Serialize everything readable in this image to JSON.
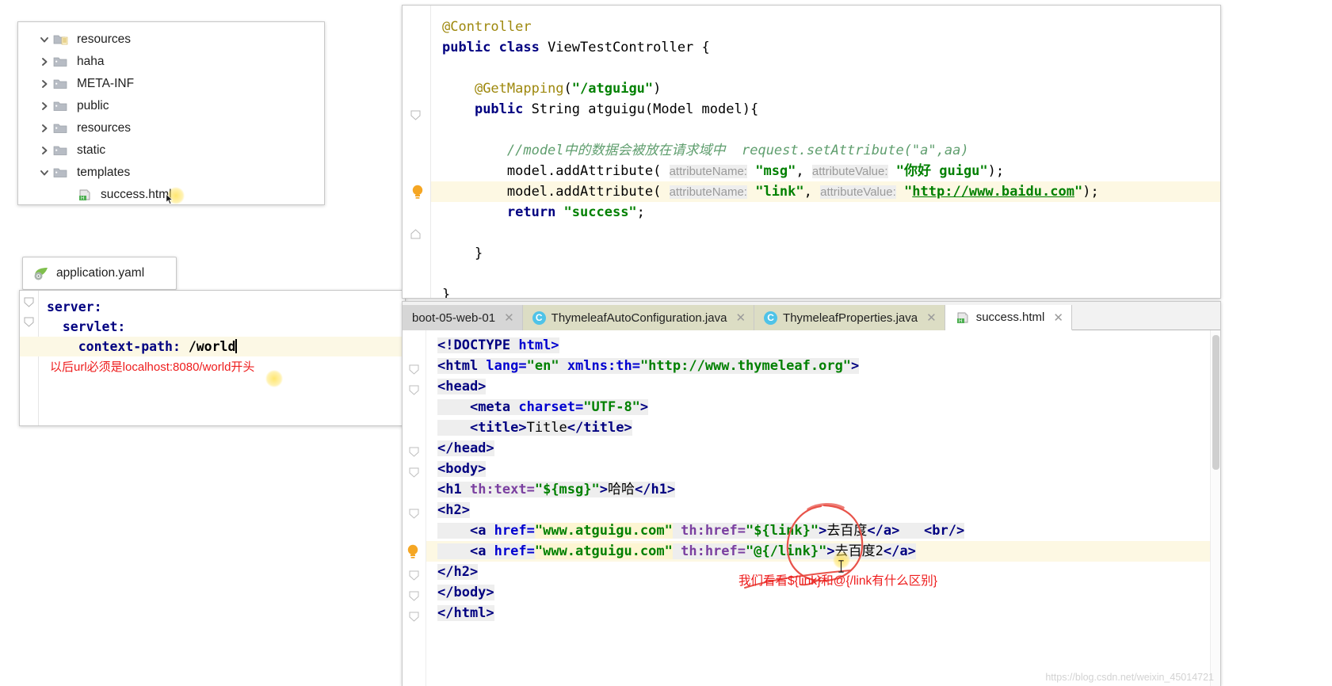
{
  "project_tree": {
    "rows": [
      {
        "label": "resources",
        "indent": 0,
        "arrow": "chevron-down",
        "icon": "resources-folder-icon",
        "expanded": true
      },
      {
        "label": "haha",
        "indent": 1,
        "arrow": "chevron-right",
        "icon": "folder-icon",
        "expanded": false
      },
      {
        "label": "META-INF",
        "indent": 1,
        "arrow": "chevron-right",
        "icon": "folder-icon",
        "expanded": false
      },
      {
        "label": "public",
        "indent": 1,
        "arrow": "chevron-right",
        "icon": "folder-icon",
        "expanded": false
      },
      {
        "label": "resources",
        "indent": 1,
        "arrow": "chevron-right",
        "icon": "folder-icon",
        "expanded": false
      },
      {
        "label": "static",
        "indent": 1,
        "arrow": "chevron-right",
        "icon": "folder-icon",
        "expanded": false
      },
      {
        "label": "templates",
        "indent": 1,
        "arrow": "chevron-down",
        "icon": "folder-icon",
        "expanded": true
      },
      {
        "label": "success.html",
        "indent": 2,
        "arrow": "none",
        "icon": "html-file-icon",
        "expanded": false
      }
    ]
  },
  "yaml_panel": {
    "tab_label": "application.yaml",
    "tab_icon": "spring-leaf-icon",
    "lines": [
      {
        "text": "server:",
        "kind": "key"
      },
      {
        "text": "  servlet:",
        "kind": "key"
      },
      {
        "text": "    context-path: ",
        "value": "/world",
        "kind": "key-value",
        "highlighted": true,
        "cursor": true
      },
      {
        "text": "以后url必须是localhost:8080/world开头",
        "kind": "red-note"
      }
    ]
  },
  "java_editor": {
    "lines": [
      {
        "id": "l1",
        "segments": [
          {
            "t": "@Controller",
            "c": "anno"
          }
        ]
      },
      {
        "id": "l2",
        "segments": [
          {
            "t": "public class ",
            "c": "kw"
          },
          {
            "t": "ViewTestController ",
            "c": "plain"
          },
          {
            "t": "{",
            "c": "plain"
          }
        ]
      },
      {
        "id": "l3",
        "segments": []
      },
      {
        "id": "l4",
        "segments": [
          {
            "t": "    ",
            "c": "plain"
          },
          {
            "t": "@GetMapping",
            "c": "anno"
          },
          {
            "t": "(",
            "c": "plain"
          },
          {
            "t": "\"/atguigu\"",
            "c": "str"
          },
          {
            "t": ")",
            "c": "plain"
          }
        ]
      },
      {
        "id": "l5",
        "segments": [
          {
            "t": "    ",
            "c": "plain"
          },
          {
            "t": "public ",
            "c": "kw"
          },
          {
            "t": "String atguigu(Model model){",
            "c": "plain"
          }
        ]
      },
      {
        "id": "l6",
        "segments": []
      },
      {
        "id": "l7",
        "segments": [
          {
            "t": "        //model中的数据会被放在请求域中  request.setAttribute(\"a\",aa)",
            "c": "cmt"
          }
        ]
      },
      {
        "id": "l8",
        "segments": [
          {
            "t": "        model.addAttribute( ",
            "c": "plain"
          },
          {
            "t": "attributeName:",
            "c": "hint"
          },
          {
            "t": " ",
            "c": "plain"
          },
          {
            "t": "\"msg\"",
            "c": "str"
          },
          {
            "t": ", ",
            "c": "plain"
          },
          {
            "t": "attributeValue:",
            "c": "hint"
          },
          {
            "t": " ",
            "c": "plain"
          },
          {
            "t": "\"你好 guigu\"",
            "c": "str"
          },
          {
            "t": ");",
            "c": "plain"
          }
        ]
      },
      {
        "id": "l9",
        "highlighted": true,
        "bulb": true,
        "segments": [
          {
            "t": "        model.addAttribute( ",
            "c": "plain"
          },
          {
            "t": "attributeName:",
            "c": "hint"
          },
          {
            "t": " ",
            "c": "plain"
          },
          {
            "t": "\"link\"",
            "c": "str"
          },
          {
            "t": ", ",
            "c": "plain"
          },
          {
            "t": "attributeValue:",
            "c": "hint"
          },
          {
            "t": " ",
            "c": "plain"
          },
          {
            "t": "\"",
            "c": "str"
          },
          {
            "t": "http://www.baidu.com",
            "c": "url"
          },
          {
            "t": "\"",
            "c": "str"
          },
          {
            "t": ");",
            "c": "plain"
          }
        ]
      },
      {
        "id": "l10",
        "segments": [
          {
            "t": "        ",
            "c": "plain"
          },
          {
            "t": "return ",
            "c": "kw"
          },
          {
            "t": "\"success\"",
            "c": "str"
          },
          {
            "t": ";",
            "c": "plain"
          }
        ]
      },
      {
        "id": "l11",
        "segments": []
      },
      {
        "id": "l12",
        "segments": [
          {
            "t": "    }",
            "c": "plain"
          }
        ]
      },
      {
        "id": "l13",
        "segments": []
      },
      {
        "id": "l14",
        "segments": [
          {
            "t": "}",
            "c": "plain"
          }
        ]
      }
    ]
  },
  "html_editor": {
    "tabs": [
      {
        "label": "boot-05-web-01",
        "icon": "none",
        "state": "inactive-grey",
        "closable": true
      },
      {
        "label": "ThymeleafAutoConfiguration.java",
        "icon": "class-icon",
        "state": "inactive-olive",
        "closable": true
      },
      {
        "label": "ThymeleafProperties.java",
        "icon": "class-icon",
        "state": "inactive-olive",
        "closable": true
      },
      {
        "label": "success.html",
        "icon": "html-file-icon",
        "state": "active",
        "closable": true
      }
    ],
    "lines": [
      {
        "id": "h1",
        "fold": false,
        "segments": [
          {
            "t": "<!DOCTYPE ",
            "c": "tag"
          },
          {
            "t": "html>",
            "c": "attr"
          }
        ]
      },
      {
        "id": "h2",
        "fold": true,
        "segments": [
          {
            "t": "<html ",
            "c": "tag"
          },
          {
            "t": "lang=",
            "c": "attr"
          },
          {
            "t": "\"en\"",
            "c": "str"
          },
          {
            "t": " ",
            "c": "txt"
          },
          {
            "t": "xmlns:th=",
            "c": "attr"
          },
          {
            "t": "\"http://www.thymeleaf.org\"",
            "c": "str"
          },
          {
            "t": ">",
            "c": "tag"
          }
        ]
      },
      {
        "id": "h3",
        "fold": true,
        "segments": [
          {
            "t": "<head>",
            "c": "tag"
          }
        ]
      },
      {
        "id": "h4",
        "fold": false,
        "segments": [
          {
            "t": "    ",
            "c": "txt"
          },
          {
            "t": "<meta ",
            "c": "tag"
          },
          {
            "t": "charset=",
            "c": "attr"
          },
          {
            "t": "\"UTF-8\"",
            "c": "str"
          },
          {
            "t": ">",
            "c": "tag"
          }
        ]
      },
      {
        "id": "h5",
        "fold": false,
        "segments": [
          {
            "t": "    ",
            "c": "txt"
          },
          {
            "t": "<title>",
            "c": "tag"
          },
          {
            "t": "Title",
            "c": "txt"
          },
          {
            "t": "</title>",
            "c": "tag"
          }
        ]
      },
      {
        "id": "h6",
        "fold": true,
        "segments": [
          {
            "t": "</head>",
            "c": "tag"
          }
        ]
      },
      {
        "id": "h7",
        "fold": true,
        "segments": [
          {
            "t": "<body>",
            "c": "tag"
          }
        ]
      },
      {
        "id": "h8",
        "fold": false,
        "segments": [
          {
            "t": "<h1 ",
            "c": "tag"
          },
          {
            "t": "th:text=",
            "c": "th"
          },
          {
            "t": "\"${msg}\"",
            "c": "str"
          },
          {
            "t": ">",
            "c": "tag"
          },
          {
            "t": "哈哈",
            "c": "txt"
          },
          {
            "t": "</h1>",
            "c": "tag"
          }
        ]
      },
      {
        "id": "h9",
        "fold": true,
        "segments": [
          {
            "t": "<h2>",
            "c": "tag"
          }
        ]
      },
      {
        "id": "h10",
        "fold": false,
        "segments": [
          {
            "t": "    ",
            "c": "txt"
          },
          {
            "t": "<a ",
            "c": "tag"
          },
          {
            "t": "href=",
            "c": "attr"
          },
          {
            "t": "\"www.atguigu.com\"",
            "c": "str-sel"
          },
          {
            "t": " ",
            "c": "txt"
          },
          {
            "t": "th:href=",
            "c": "th"
          },
          {
            "t": "\"${link}\"",
            "c": "str"
          },
          {
            "t": ">",
            "c": "tag"
          },
          {
            "t": "去百度",
            "c": "txt"
          },
          {
            "t": "</a>",
            "c": "tag"
          },
          {
            "t": "   ",
            "c": "txt"
          },
          {
            "t": "<br/>",
            "c": "tag"
          }
        ]
      },
      {
        "id": "h11",
        "fold": false,
        "highlighted": true,
        "bulb": true,
        "segments": [
          {
            "t": "    ",
            "c": "txt"
          },
          {
            "t": "<a ",
            "c": "tag"
          },
          {
            "t": "href=",
            "c": "attr"
          },
          {
            "t": "\"www.atguigu.com\"",
            "c": "str-sel"
          },
          {
            "t": " ",
            "c": "txt"
          },
          {
            "t": "th:href=",
            "c": "th"
          },
          {
            "t": "\"@{/link}\"",
            "c": "str"
          },
          {
            "t": ">",
            "c": "tag"
          },
          {
            "t": "去百度2",
            "c": "txt"
          },
          {
            "t": "</a>",
            "c": "tag"
          }
        ]
      },
      {
        "id": "h12",
        "fold": true,
        "segments": [
          {
            "t": "</h2>",
            "c": "tag"
          }
        ]
      },
      {
        "id": "h13",
        "fold": true,
        "segments": [
          {
            "t": "</body>",
            "c": "tag"
          }
        ]
      },
      {
        "id": "h14",
        "fold": true,
        "segments": [
          {
            "t": "</html>",
            "c": "tag"
          }
        ]
      }
    ],
    "red_annotation": "我们看看${link}和@{/link有什么区别}"
  },
  "watermark": "https://blog.csdn.net/weixin_45014721",
  "colors": {
    "keyword": "#000080",
    "string": "#008000",
    "annotation": "#9e880d",
    "comment": "#5f9e6e",
    "thymeleaf_attr": "#7a3fa0",
    "red_note": "#ee1c1c",
    "highlight_line": "#fdf8e3",
    "tab_olive": "#dcddc4",
    "tab_grey": "#d6d6d6",
    "class_icon": "#4fc3e8"
  }
}
